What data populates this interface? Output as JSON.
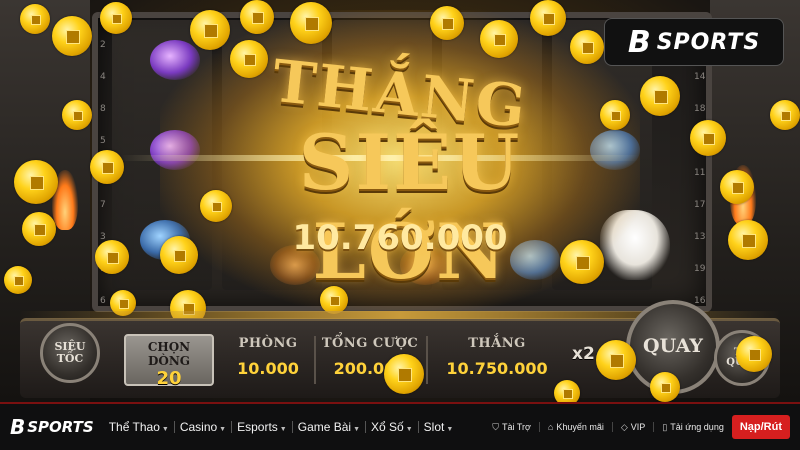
{
  "game": {
    "win_title_line1": "THẮNG",
    "win_title_line2": "SIÊU LỚN",
    "win_amount": "10.760.000",
    "paylines_left": [
      "2",
      "4",
      "8",
      "5",
      "1",
      "7",
      "3",
      "9",
      "6"
    ],
    "paylines_right": [
      "12",
      "14",
      "18",
      "15",
      "11",
      "17",
      "13",
      "19",
      "16",
      "20"
    ],
    "controls": {
      "speed_button": "SIÊU TỐC",
      "line_select_label": "CHỌN DÒNG",
      "line_select_value": "20",
      "room_label": "PHÒNG",
      "room_value": "10.000",
      "bet_label": "TỔNG CƯỢC",
      "bet_value": "200.000",
      "win_label": "THẮNG",
      "win_value": "10.750.000",
      "multiplier": "x2",
      "spin_button": "QUAY",
      "auto_button": "TỰ QUAY"
    }
  },
  "brand": {
    "mark": "B",
    "word": "SPORTS"
  },
  "nav": {
    "items": [
      {
        "label": "Thể Thao"
      },
      {
        "label": "Casino"
      },
      {
        "label": "Esports"
      },
      {
        "label": "Game Bài"
      },
      {
        "label": "Xổ Số"
      },
      {
        "label": "Slot"
      }
    ],
    "utilities": [
      {
        "label": "Tài Trợ",
        "icon": "shield-icon"
      },
      {
        "label": "Khuyến mãi",
        "icon": "tag-icon"
      },
      {
        "label": "VIP",
        "icon": "diamond-icon"
      },
      {
        "label": "Tải ứng dụng",
        "icon": "phone-icon"
      }
    ],
    "cta": "Nạp/Rút"
  },
  "colors": {
    "gold": "#f6c85a",
    "cta_red": "#d61f1f",
    "nav_bg": "#0f0f10"
  }
}
